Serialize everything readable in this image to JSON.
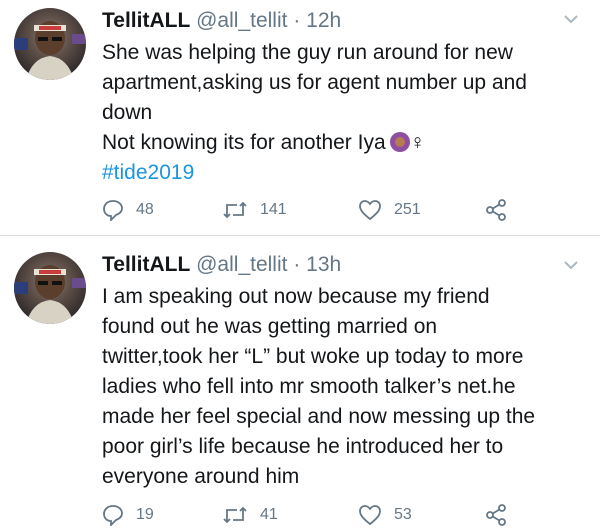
{
  "tweets": [
    {
      "name": "TellitALL",
      "handle": "@all_tellit",
      "separator": "·",
      "time": "12h",
      "lines": [
        "She was helping the guy run around for new",
        "apartment,asking us for agent number up and",
        "down",
        "Not knowing its for another Iya"
      ],
      "emoji": "woman-facepalming-emoji",
      "gender_symbol": "♀",
      "hashtag": "#tide2019",
      "replies": "48",
      "retweets": "141",
      "likes": "251"
    },
    {
      "name": "TellitALL",
      "handle": "@all_tellit",
      "separator": "·",
      "time": "13h",
      "lines": [
        "I am speaking out now because my friend",
        "found out he was getting married on",
        "twitter,took her “L” but woke up today to more",
        "ladies who fell into mr smooth talker’s net.he",
        "made her feel special and now messing up the",
        "poor girl’s life because he introduced her to",
        "everyone around him"
      ],
      "replies": "19",
      "retweets": "41",
      "likes": "53"
    }
  ],
  "icons": {
    "reply": "reply-icon",
    "retweet": "retweet-icon",
    "like": "heart-icon",
    "share": "share-icon",
    "menu": "chevron-down-icon"
  },
  "colors": {
    "text": "#14171a",
    "muted": "#657786",
    "link": "#1b95e0",
    "divider": "#d9dee2"
  }
}
